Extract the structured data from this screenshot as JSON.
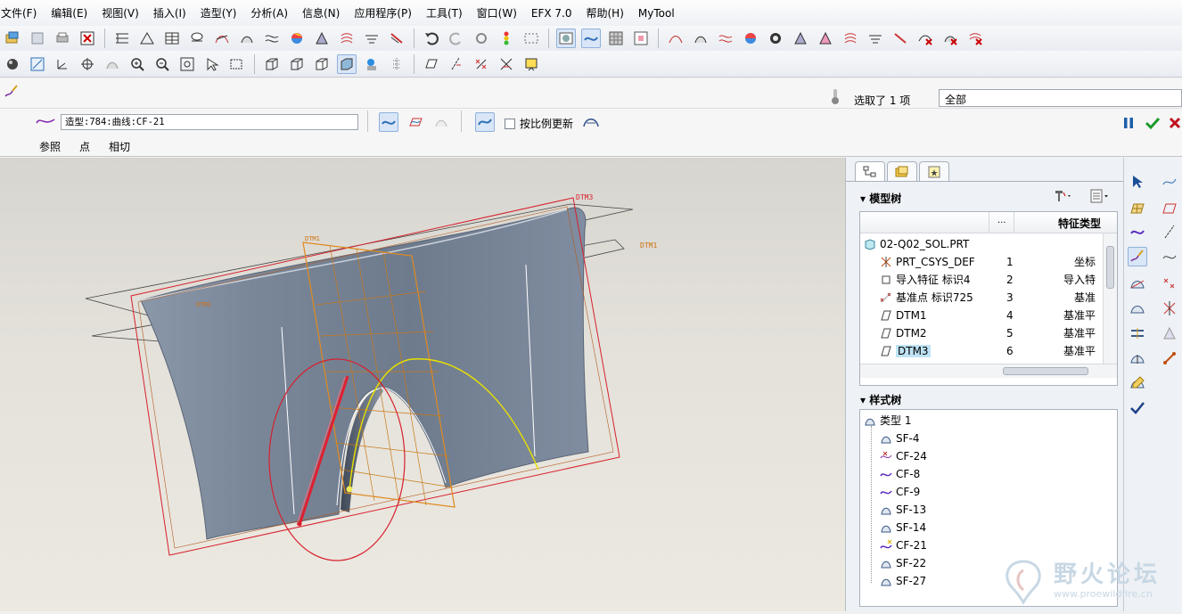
{
  "menu": [
    "文件(F)",
    "编辑(E)",
    "视图(V)",
    "插入(I)",
    "造型(Y)",
    "分析(A)",
    "信息(N)",
    "应用程序(P)",
    "工具(T)",
    "窗口(W)",
    "EFX 7.0",
    "帮助(H)",
    "MyTool"
  ],
  "dashboard": {
    "feature_value": "造型:784:曲线:CF-21",
    "proportional_update_label": "按比例更新",
    "selection_info": "选取了 1 项",
    "filter_value": "全部",
    "tabs": [
      "参照",
      "点",
      "相切"
    ]
  },
  "model_tree": {
    "title": "模型树",
    "col_dots": "...",
    "col_type": "特征类型",
    "root": "02-Q02_SOL.PRT",
    "rows": [
      {
        "name": "PRT_CSYS_DEF",
        "num": "1",
        "type": "坐标"
      },
      {
        "name": "导入特征 标识4",
        "num": "2",
        "type": "导入特"
      },
      {
        "name": "基准点 标识725",
        "num": "3",
        "type": "基准"
      },
      {
        "name": "DTM1",
        "num": "4",
        "type": "基准平"
      },
      {
        "name": "DTM2",
        "num": "5",
        "type": "基准平"
      },
      {
        "name": "DTM3",
        "num": "6",
        "type": "基准平"
      }
    ]
  },
  "style_tree": {
    "title": "样式树",
    "root": "类型 1",
    "items": [
      "SF-4",
      "CF-24",
      "CF-8",
      "CF-9",
      "SF-13",
      "SF-14",
      "CF-21",
      "SF-22",
      "SF-27"
    ]
  },
  "viewport_labels": {
    "dtm3": "DTM3",
    "dtm1": "DTM1",
    "dtm2": "DTM2",
    "dtm_top": "DTM1"
  },
  "watermark": {
    "text": "野火论坛",
    "url": "www.proewildfire.cn"
  },
  "colors": {
    "accent": "#2d6fb7",
    "curve_red": "#d8202c",
    "curve_yellow": "#e8e000",
    "datum_orange": "#e08a20",
    "surface": "#6f7d90"
  }
}
